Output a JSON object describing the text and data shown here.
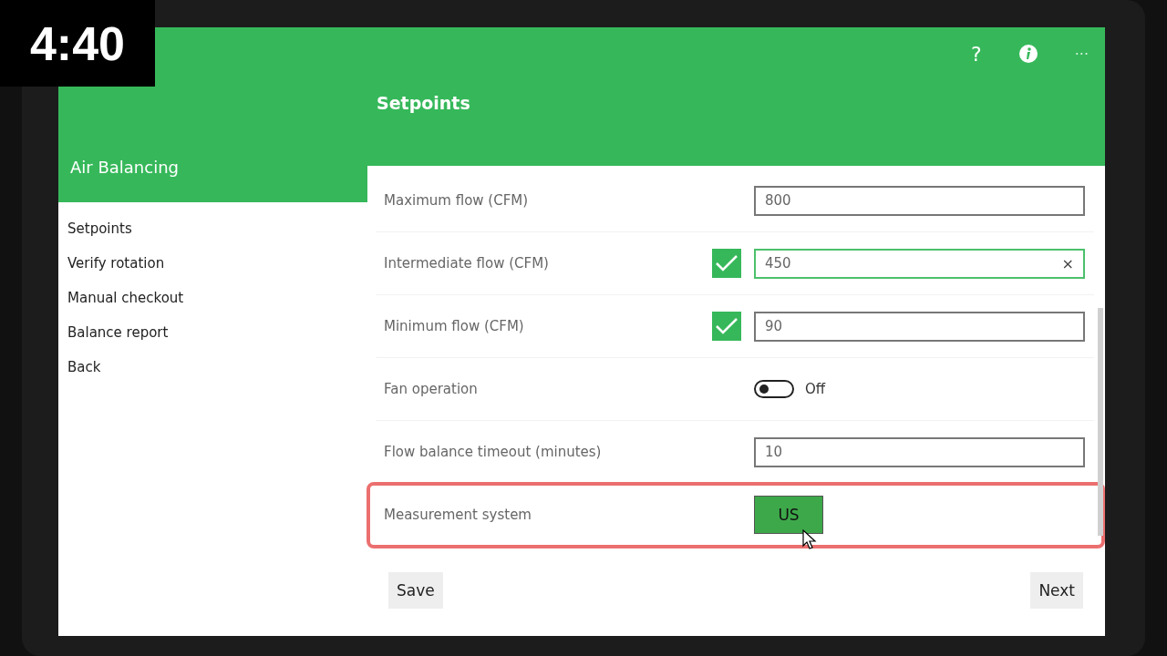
{
  "timer": "4:40",
  "header": {
    "help": "?",
    "more": "···",
    "title": "Setpoints"
  },
  "sidebar": {
    "title": "Air Balancing",
    "items": [
      {
        "label": "Setpoints"
      },
      {
        "label": "Verify rotation"
      },
      {
        "label": "Manual checkout"
      },
      {
        "label": "Balance report"
      },
      {
        "label": "Back"
      }
    ]
  },
  "rows": [
    {
      "kind": "field",
      "label": "Maximum flow (CFM)",
      "value": "800",
      "focused": false,
      "highlighted": false
    },
    {
      "kind": "field",
      "label": "Intermediate flow (CFM)",
      "value": "450",
      "checked": true,
      "focused": true,
      "clear": "×",
      "highlighted": false
    },
    {
      "kind": "field",
      "label": "Minimum flow (CFM)",
      "value": "90",
      "checked": true,
      "focused": false,
      "highlighted": false
    },
    {
      "kind": "toggle",
      "label": "Fan operation",
      "on": false,
      "state_label": "Off",
      "highlighted": false
    },
    {
      "kind": "field",
      "label": "Flow balance timeout (minutes)",
      "value": "10",
      "focused": false,
      "highlighted": false
    },
    {
      "kind": "button",
      "label": "Measurement system",
      "value": "US",
      "highlighted": true
    }
  ],
  "footer": {
    "save": "Save",
    "next": "Next"
  }
}
